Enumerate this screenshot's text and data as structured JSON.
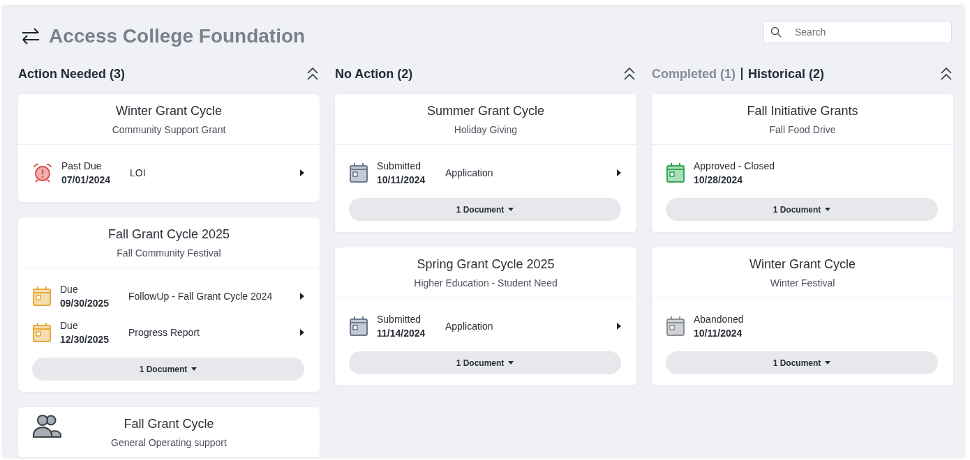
{
  "header": {
    "title": "Access College Foundation",
    "search": {
      "placeholder": "Search"
    }
  },
  "columns": [
    {
      "tabs": [
        {
          "label": "Action Needed (3)",
          "selected": true
        }
      ],
      "cards": [
        {
          "title": "Winter Grant Cycle",
          "subtitle": "Community Support Grant",
          "tasks": [
            {
              "kind": "alarm",
              "color": "#d9534f",
              "status": "Past Due",
              "date": "07/01/2024",
              "name": "LOI",
              "arrow": true
            }
          ]
        },
        {
          "title": "Fall Grant Cycle 2025",
          "subtitle": "Fall Community Festival",
          "tasks": [
            {
              "kind": "calendar",
              "color": "#e8a93a",
              "status": "Due",
              "date": "09/30/2025",
              "name": "FollowUp - Fall Grant Cycle 2024",
              "arrow": true
            },
            {
              "kind": "calendar",
              "color": "#e8a93a",
              "status": "Due",
              "date": "12/30/2025",
              "name": "Progress Report",
              "arrow": true
            }
          ],
          "documents": "1 Document"
        },
        {
          "title": "Fall Grant Cycle",
          "subtitle": "General Operating support",
          "people": true
        }
      ]
    },
    {
      "tabs": [
        {
          "label": "No Action (2)",
          "selected": true
        }
      ],
      "cards": [
        {
          "title": "Summer Grant Cycle",
          "subtitle": "Holiday Giving",
          "tasks": [
            {
              "kind": "calendar",
              "color": "#6b7a8f",
              "status": "Submitted",
              "date": "10/11/2024",
              "name": "Application",
              "arrow": true
            }
          ],
          "documents": "1 Document"
        },
        {
          "title": "Spring Grant Cycle 2025",
          "subtitle": "Higher Education - Student Need",
          "tasks": [
            {
              "kind": "calendar",
              "color": "#6b7a8f",
              "status": "Submitted",
              "date": "11/14/2024",
              "name": "Application",
              "arrow": true
            }
          ],
          "documents": "1 Document"
        }
      ]
    },
    {
      "tabs": [
        {
          "label": "Completed (1)",
          "selected": false
        },
        {
          "label": "Historical (2)",
          "selected": true
        }
      ],
      "cards": [
        {
          "title": "Fall Initiative Grants",
          "subtitle": "Fall Food Drive",
          "tasks": [
            {
              "kind": "calendar",
              "color": "#2fa955",
              "status": "Approved - Closed",
              "date": "10/28/2024",
              "arrow": false
            }
          ],
          "documents": "1 Document"
        },
        {
          "title": "Winter Grant Cycle",
          "subtitle": "Winter Festival",
          "tasks": [
            {
              "kind": "calendar",
              "color": "#8a8f98",
              "status": "Abandoned",
              "date": "10/11/2024",
              "arrow": false
            }
          ],
          "documents": "1 Document"
        }
      ]
    }
  ]
}
